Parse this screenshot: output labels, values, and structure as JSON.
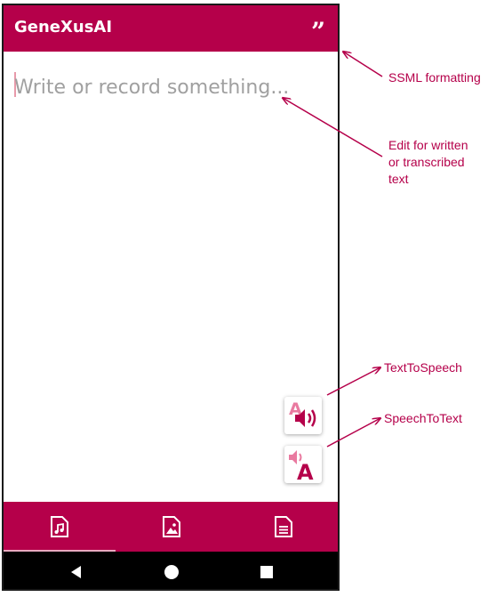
{
  "app": {
    "title": "GeneXusAI"
  },
  "editor": {
    "placeholder": "Write or record something..."
  },
  "icons": {
    "ssml": "format-quote-icon",
    "text_to_speech": "text-to-speech-icon",
    "speech_to_text": "speech-to-text-icon",
    "tab_audio": "audio-file-icon",
    "tab_image": "image-file-icon",
    "tab_document": "document-file-icon",
    "back": "back-triangle-icon",
    "home": "home-circle-icon",
    "recents": "recents-square-icon"
  },
  "bottom_nav": {
    "selected": "audio"
  },
  "annotations": {
    "ssml": "SSML formatting",
    "edit_line1": "Edit for written",
    "edit_line2": "or transcribed",
    "edit_line3": "text",
    "tts": "TextToSpeech",
    "stt": "SpeechToText"
  },
  "colors": {
    "brand": "#b5004a",
    "brand_light": "#e97aa0",
    "annotation": "#b5004a",
    "system_bar": "#000000"
  }
}
